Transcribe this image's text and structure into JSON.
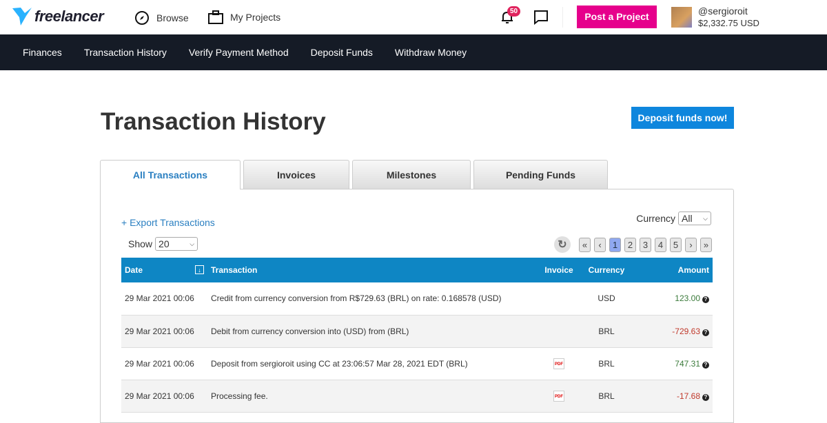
{
  "header": {
    "logo": "freelancer",
    "browse": "Browse",
    "my_projects": "My Projects",
    "notifications": "50",
    "post_project": "Post a Project",
    "username": "@sergioroit",
    "balance": "$2,332.75 USD"
  },
  "subnav": [
    "Finances",
    "Transaction History",
    "Verify Payment Method",
    "Deposit Funds",
    "Withdraw Money"
  ],
  "page": {
    "title": "Transaction History",
    "deposit_button": "Deposit funds now!"
  },
  "tabs": [
    "All Transactions",
    "Invoices",
    "Milestones",
    "Pending Funds"
  ],
  "controls": {
    "export": "+ Export Transactions",
    "currency_label": "Currency",
    "currency_value": "All",
    "show_label": "Show",
    "show_value": "20",
    "pages": [
      "«",
      "‹",
      "1",
      "2",
      "3",
      "4",
      "5",
      "›",
      "»"
    ]
  },
  "table": {
    "headers": [
      "Date",
      "Transaction",
      "Invoice",
      "Currency",
      "Amount"
    ],
    "rows": [
      {
        "date": "29 Mar 2021 00:06",
        "transaction": "Credit from currency conversion from R$729.63 (BRL) on rate: 0.168578 (USD)",
        "invoice": false,
        "currency": "USD",
        "amount": "123.00"
      },
      {
        "date": "29 Mar 2021 00:06",
        "transaction": "Debit from currency conversion into (USD) from (BRL)",
        "invoice": false,
        "currency": "BRL",
        "amount": "-729.63"
      },
      {
        "date": "29 Mar 2021 00:06",
        "transaction": "Deposit from sergioroit using CC at 23:06:57 Mar 28, 2021 EDT (BRL)",
        "invoice": true,
        "currency": "BRL",
        "amount": "747.31"
      },
      {
        "date": "29 Mar 2021 00:06",
        "transaction": "Processing fee.",
        "invoice": true,
        "currency": "BRL",
        "amount": "-17.68"
      }
    ]
  }
}
